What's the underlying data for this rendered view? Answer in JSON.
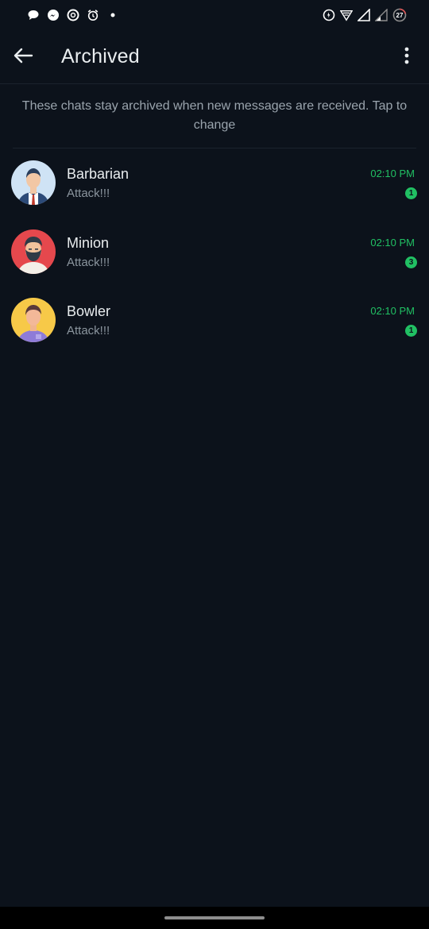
{
  "status_bar": {
    "left_icons": [
      "chat-bubble-icon",
      "messenger-icon",
      "openai-icon",
      "alarm-icon",
      "dot-icon"
    ],
    "right_icons": [
      "data-saver-icon",
      "wifi-icon",
      "signal-icon",
      "signal-weak-icon"
    ],
    "battery_level": "27"
  },
  "header": {
    "title": "Archived",
    "back_icon": "arrow-left-icon",
    "menu_icon": "more-vert-icon"
  },
  "notice": {
    "text": "These chats stay archived when new messages are received. Tap to change"
  },
  "chats": [
    {
      "name": "Barbarian",
      "preview": "Attack!!!",
      "time": "02:10 PM",
      "unread": "1",
      "avatar": "businessman-avatar"
    },
    {
      "name": "Minion",
      "preview": "Attack!!!",
      "time": "02:10 PM",
      "unread": "3",
      "avatar": "bearded-man-avatar"
    },
    {
      "name": "Bowler",
      "preview": "Attack!!!",
      "time": "02:10 PM",
      "unread": "1",
      "avatar": "young-man-avatar"
    }
  ],
  "colors": {
    "background": "#0c121b",
    "accent_green": "#21c063",
    "text_primary": "#e9edef",
    "text_secondary": "#8b959e"
  }
}
